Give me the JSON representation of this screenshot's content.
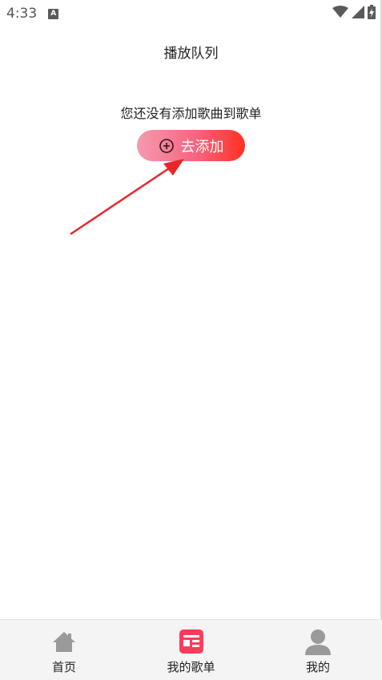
{
  "status_bar": {
    "time": "4:33",
    "notification_icon": "a-icon",
    "icons": [
      "wifi-icon",
      "signal-icon",
      "battery-icon"
    ]
  },
  "header": {
    "title": "播放队列"
  },
  "empty_state": {
    "message": "您还没有添加歌曲到歌单",
    "button_label": "去添加",
    "button_icon": "plus-circle-icon"
  },
  "bottom_nav": {
    "items": [
      {
        "label": "首页",
        "icon": "home-icon",
        "active": false
      },
      {
        "label": "我的歌单",
        "icon": "playlist-icon",
        "active": true
      },
      {
        "label": "我的",
        "icon": "user-icon",
        "active": false
      }
    ]
  },
  "colors": {
    "accent": "#ff3b5c",
    "inactive_icon": "#9a9a9a",
    "button_gradient_start": "#f59ab0",
    "button_gradient_end": "#ff3022",
    "annotation_arrow": "#e8262a"
  }
}
